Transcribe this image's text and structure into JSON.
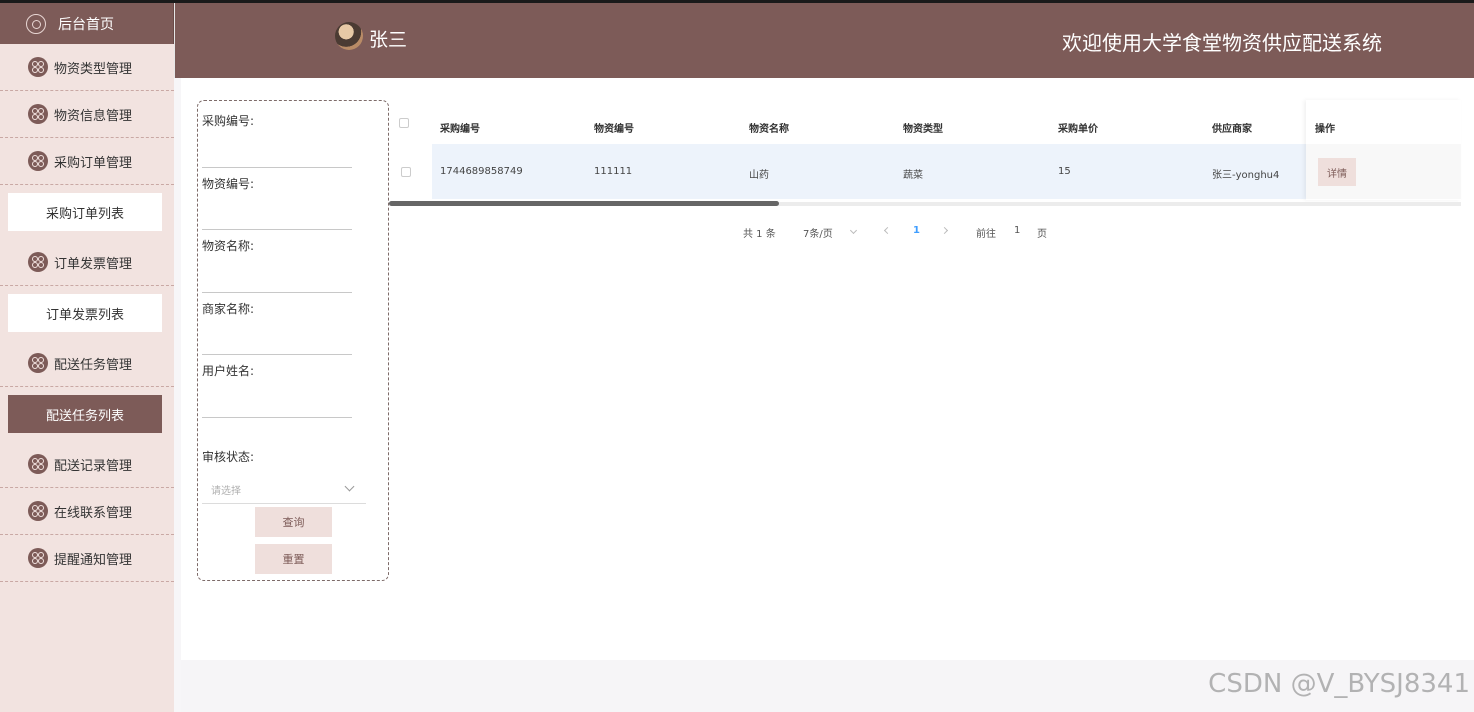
{
  "sidebar": {
    "home": "后台首页",
    "items": [
      {
        "label": "物资类型管理"
      },
      {
        "label": "物资信息管理"
      },
      {
        "label": "采购订单管理"
      },
      {
        "label": "采购订单列表"
      },
      {
        "label": "订单发票管理"
      },
      {
        "label": "订单发票列表"
      },
      {
        "label": "配送任务管理"
      },
      {
        "label": "配送任务列表"
      },
      {
        "label": "配送记录管理"
      },
      {
        "label": "在线联系管理"
      },
      {
        "label": "提醒通知管理"
      }
    ]
  },
  "header": {
    "username": "张三",
    "title": "欢迎使用大学食堂物资供应配送系统"
  },
  "search": {
    "fields": [
      "采购编号:",
      "物资编号:",
      "物资名称:",
      "商家名称:",
      "用户姓名:"
    ],
    "status_label": "审核状态:",
    "status_placeholder": "请选择",
    "query_button": "查询",
    "reset_button": "重置"
  },
  "table": {
    "columns": [
      "采购编号",
      "物资编号",
      "物资名称",
      "物资类型",
      "采购单价",
      "供应商家",
      "操作"
    ],
    "rows": [
      [
        "1744689858749",
        "111111",
        "山药",
        "蔬菜",
        "15",
        "张三-yonghu4"
      ]
    ],
    "detail_button": "详情"
  },
  "pagination": {
    "total": "共 1 条",
    "page_size": "7条/页",
    "current_page": "1",
    "goto_prefix": "前往",
    "goto_value": "1",
    "goto_suffix": "页"
  },
  "watermark": "CSDN @V_BYSJ8341"
}
